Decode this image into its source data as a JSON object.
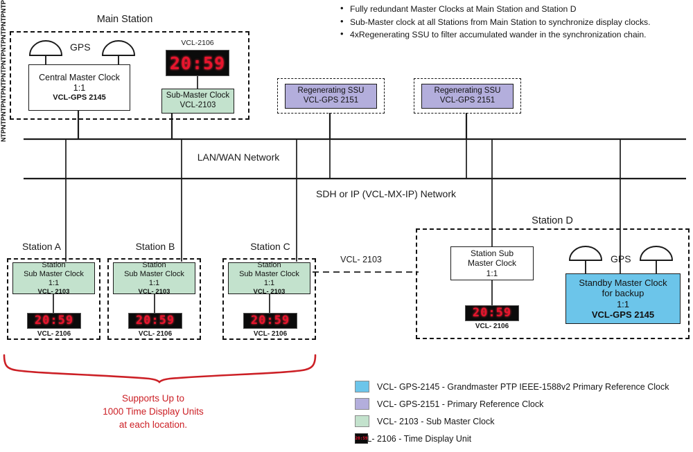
{
  "diagram": {
    "title_main_station": "Main Station",
    "title_station_d": "Station D",
    "bullets": [
      "Fully redundant Master Clocks at Main Station and Station D",
      "Sub-Master clock at all Stations from Main Station to synchronize display clocks.",
      "4xRegenerating SSU to filter accumulated wander in the synchronization chain."
    ],
    "networks": {
      "lan_wan": "LAN/WAN Network",
      "sdh_ip": "SDH or IP (VCL-MX-IP) Network"
    },
    "link_labels": {
      "ntp": "NTP",
      "vcl_2103_link": "VCL- 2103"
    },
    "main_station": {
      "gps_label": "GPS",
      "central_master_clock": {
        "line1": "Central Master Clock",
        "line2": "1:1",
        "line3": "VCL-GPS 2145"
      },
      "display_model": "VCL-2106",
      "display_time": "20:59",
      "sub_master_clock": {
        "line1": "Sub-Master Clock",
        "line2": "VCL-2103"
      }
    },
    "regenerating_ssu": [
      {
        "line1": "Regenerating SSU",
        "line2": "VCL-GPS 2151"
      },
      {
        "line1": "Regenerating SSU",
        "line2": "VCL-GPS 2151"
      }
    ],
    "stations": [
      {
        "name": "Station A",
        "sub_master": {
          "line1": "Station",
          "line2": "Sub Master Clock",
          "line3": "1:1",
          "line4": "VCL- 2103"
        },
        "display_time": "20:59",
        "display_model": "VCL- 2106"
      },
      {
        "name": "Station B",
        "sub_master": {
          "line1": "Station",
          "line2": "Sub Master Clock",
          "line3": "1:1",
          "line4": "VCL- 2103"
        },
        "display_time": "20:59",
        "display_model": "VCL- 2106"
      },
      {
        "name": "Station C",
        "sub_master": {
          "line1": "Station",
          "line2": "Sub Master Clock",
          "line3": "1:1",
          "line4": "VCL- 2103"
        },
        "display_time": "20:59",
        "display_model": "VCL- 2106"
      }
    ],
    "station_d": {
      "name": "Station D",
      "gps_label": "GPS",
      "sub_master": {
        "line1": "Station Sub",
        "line2": "Master Clock",
        "line3": "1:1"
      },
      "display_time": "20:59",
      "display_model": "VCL- 2106",
      "standby_master": {
        "line1": "Standby Master Clock",
        "line2": "for backup",
        "line3": "1:1",
        "line4": "VCL-GPS 2145"
      }
    },
    "red_note": {
      "line1": "Supports Up to",
      "line2": "1000 Time Display Units",
      "line3": "at each location."
    },
    "legend": [
      {
        "color": "#6cc5ea",
        "text": "VCL- GPS-2145 - Grandmaster PTP IEEE-1588v2 Primary Reference Clock",
        "kind": "swatch"
      },
      {
        "color": "#b3aedc",
        "text": "VCL- GPS-2151 - Primary Reference Clock",
        "kind": "swatch"
      },
      {
        "color": "#c3e2cd",
        "text": "VCL- 2103 - Sub Master Clock",
        "kind": "swatch"
      },
      {
        "color": "#0b0b0b",
        "text": "VCL- 2106 - Time Display Unit",
        "kind": "clock",
        "clock_text": "20:59"
      }
    ],
    "colors": {
      "blue": "#6cc5ea",
      "purple": "#b3aedc",
      "green": "#c3e2cd",
      "red": "#cc2026",
      "clock_red": "#e8142d",
      "line": "#1a1a1a"
    }
  }
}
